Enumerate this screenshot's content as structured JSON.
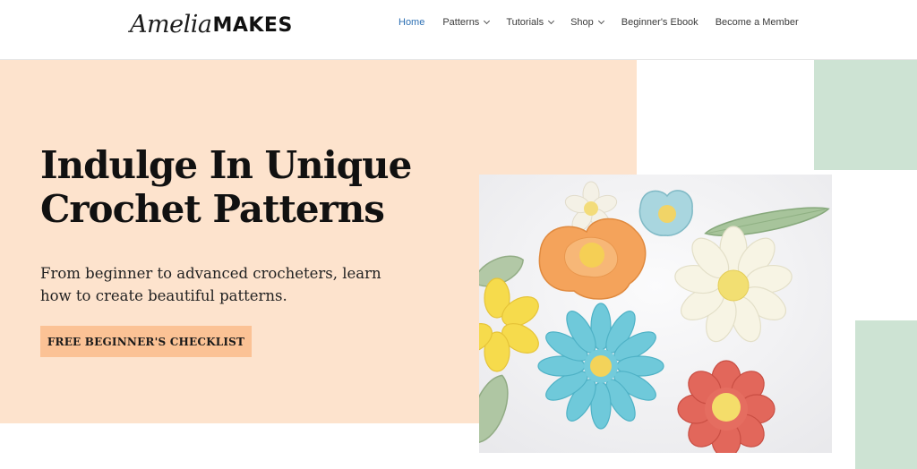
{
  "header": {
    "logo_script": "Amelia",
    "logo_bold": "MAKES",
    "nav": [
      {
        "label": "Home",
        "active": true,
        "dropdown": false
      },
      {
        "label": "Patterns",
        "active": false,
        "dropdown": true
      },
      {
        "label": "Tutorials",
        "active": false,
        "dropdown": true
      },
      {
        "label": "Shop",
        "active": false,
        "dropdown": true
      },
      {
        "label": "Beginner's Ebook",
        "active": false,
        "dropdown": false
      },
      {
        "label": "Become a Member",
        "active": false,
        "dropdown": false
      }
    ]
  },
  "hero": {
    "title_line1": "Indulge In Unique",
    "title_line2": "Crochet Patterns",
    "subtitle_line1": "From beginner to advanced crocheters, learn",
    "subtitle_line2": "how to create beautiful patterns.",
    "cta_label": "FREE BEGINNER'S CHECKLIST",
    "image_subject": "crochet-flowers-photo"
  },
  "colors": {
    "hero_bg": "#fde3cd",
    "accent_green": "#cde3d3",
    "cta_bg": "#fbc295",
    "nav_active": "#2c6fb3"
  }
}
